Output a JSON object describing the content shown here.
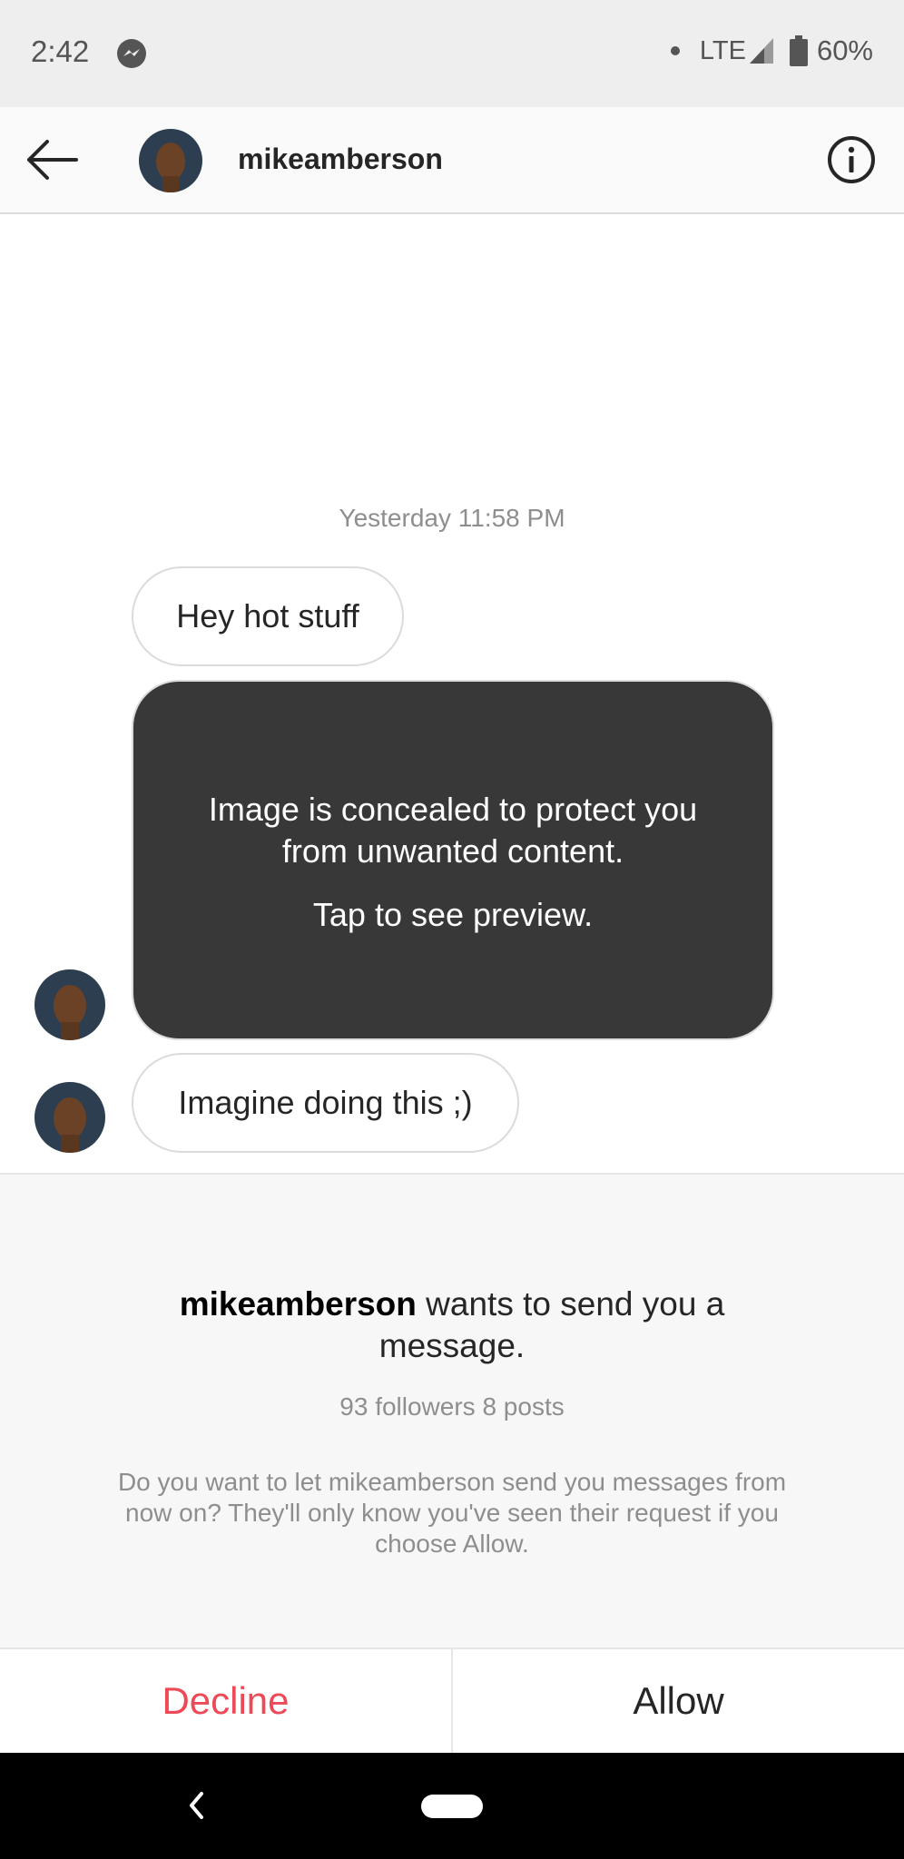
{
  "status_bar": {
    "time": "2:42",
    "network": "LTE",
    "battery": "60%",
    "icons": [
      "messenger-icon",
      "dot-icon",
      "signal-icon",
      "battery-icon"
    ]
  },
  "header": {
    "username": "mikeamberson",
    "icons": [
      "back-arrow-icon",
      "info-icon"
    ]
  },
  "conversation": {
    "timestamp": "Yesterday 11:58 PM",
    "messages": [
      {
        "text": "Hey hot stuff"
      },
      {
        "concealed_title": "Image is concealed to protect you from unwanted content.",
        "concealed_action": "Tap to see preview."
      },
      {
        "text": "Imagine doing this ;)"
      }
    ]
  },
  "request": {
    "username": "mikeamberson",
    "title_rest": " wants to send you a message.",
    "stats": "93 followers 8 posts",
    "description": "Do you want to let mikeamberson send you messages from now on? They'll only know you've seen their request if you choose Allow."
  },
  "actions": {
    "decline": "Decline",
    "allow": "Allow"
  },
  "colors": {
    "decline": "#ed4956",
    "concealed_bg": "#383838",
    "panel_bg": "#f7f7f7"
  }
}
